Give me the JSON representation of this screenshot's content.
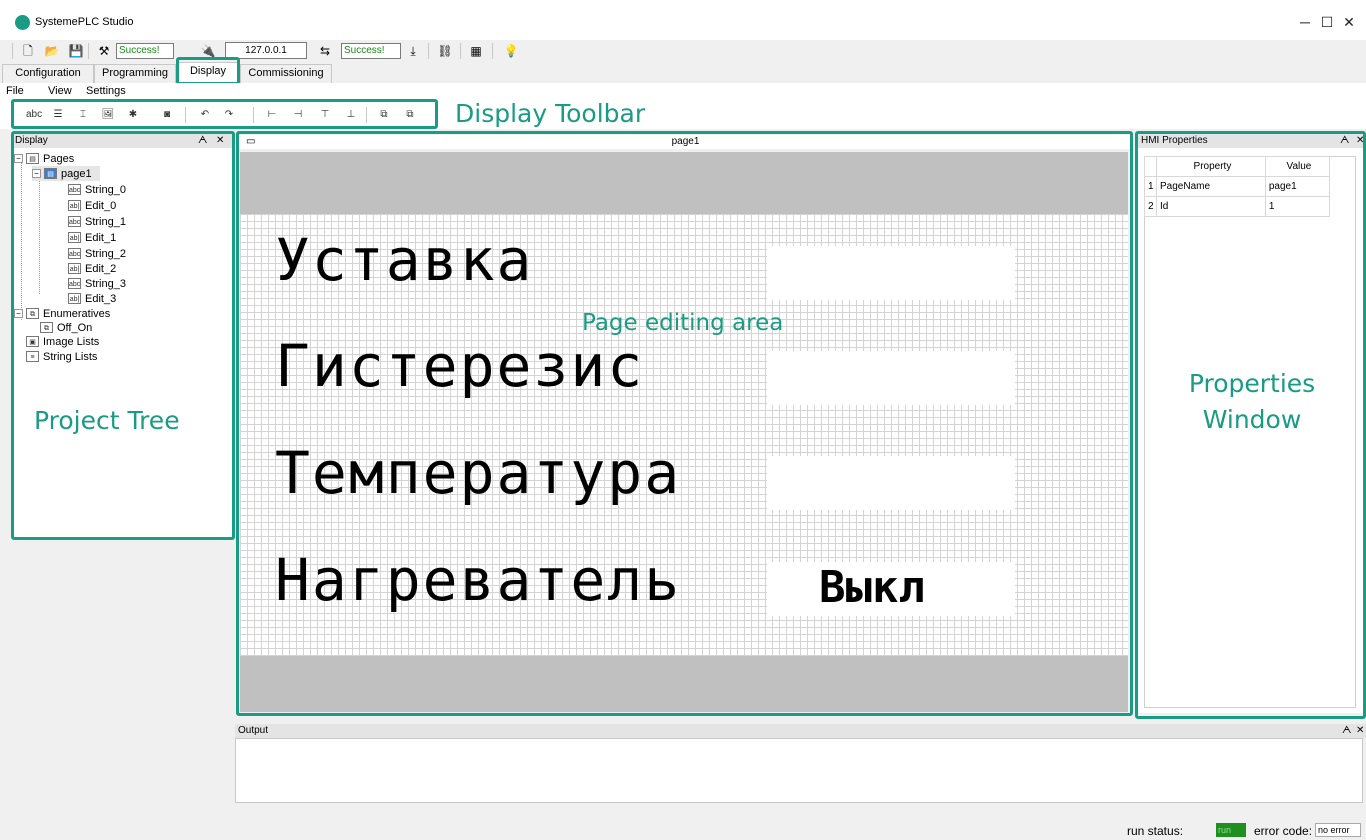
{
  "window": {
    "title": "SystemePLC Studio",
    "minimize": "─",
    "maximize": "☐",
    "close": "✕"
  },
  "quickbar": {
    "status1": "Success!",
    "ip_address": "127.0.0.1",
    "status2": "Success!"
  },
  "tabs": [
    {
      "label": "Configuration"
    },
    {
      "label": "Programming"
    },
    {
      "label": "Display",
      "active": true
    },
    {
      "label": "Commissioning"
    }
  ],
  "menu": [
    "File",
    "View",
    "Settings"
  ],
  "annotations": {
    "display_toolbar": "Display Toolbar",
    "page_editing_area": "Page editing area",
    "project_tree": "Project Tree",
    "properties_window_line1": "Properties",
    "properties_window_line2": "Window",
    "color": "#1a9b84"
  },
  "display_panel": {
    "title": "Display",
    "pin": "ᗅ",
    "close": "✕"
  },
  "tree": {
    "pages": "Pages",
    "page1": "page1",
    "children": [
      "String_0",
      "Edit_0",
      "String_1",
      "Edit_1",
      "String_2",
      "Edit_2",
      "String_3",
      "Edit_3"
    ],
    "enumeratives": "Enumeratives",
    "off_on": "Off_On",
    "image_lists": "Image Lists",
    "string_lists": "String Lists",
    "icon_string": "abc",
    "icon_edit": "ab|"
  },
  "editor": {
    "title": "page1",
    "rows": [
      {
        "label": "Уставка",
        "value": ""
      },
      {
        "label": "Гистерезис",
        "value": ""
      },
      {
        "label": "Температура",
        "value": ""
      },
      {
        "label": "Нагреватель",
        "value": "Выкл"
      }
    ]
  },
  "hmi_properties": {
    "title": "HMI Properties",
    "headers": [
      "Property",
      "Value"
    ],
    "rows": [
      {
        "index": "1",
        "property": "PageName",
        "value": "page1"
      },
      {
        "index": "2",
        "property": "Id",
        "value": "1"
      }
    ]
  },
  "output": {
    "title": "Output"
  },
  "statusbar": {
    "run_status_label": "run status:",
    "run_status_value": "run",
    "error_code_label": "error code:",
    "error_code_value": "no error"
  }
}
